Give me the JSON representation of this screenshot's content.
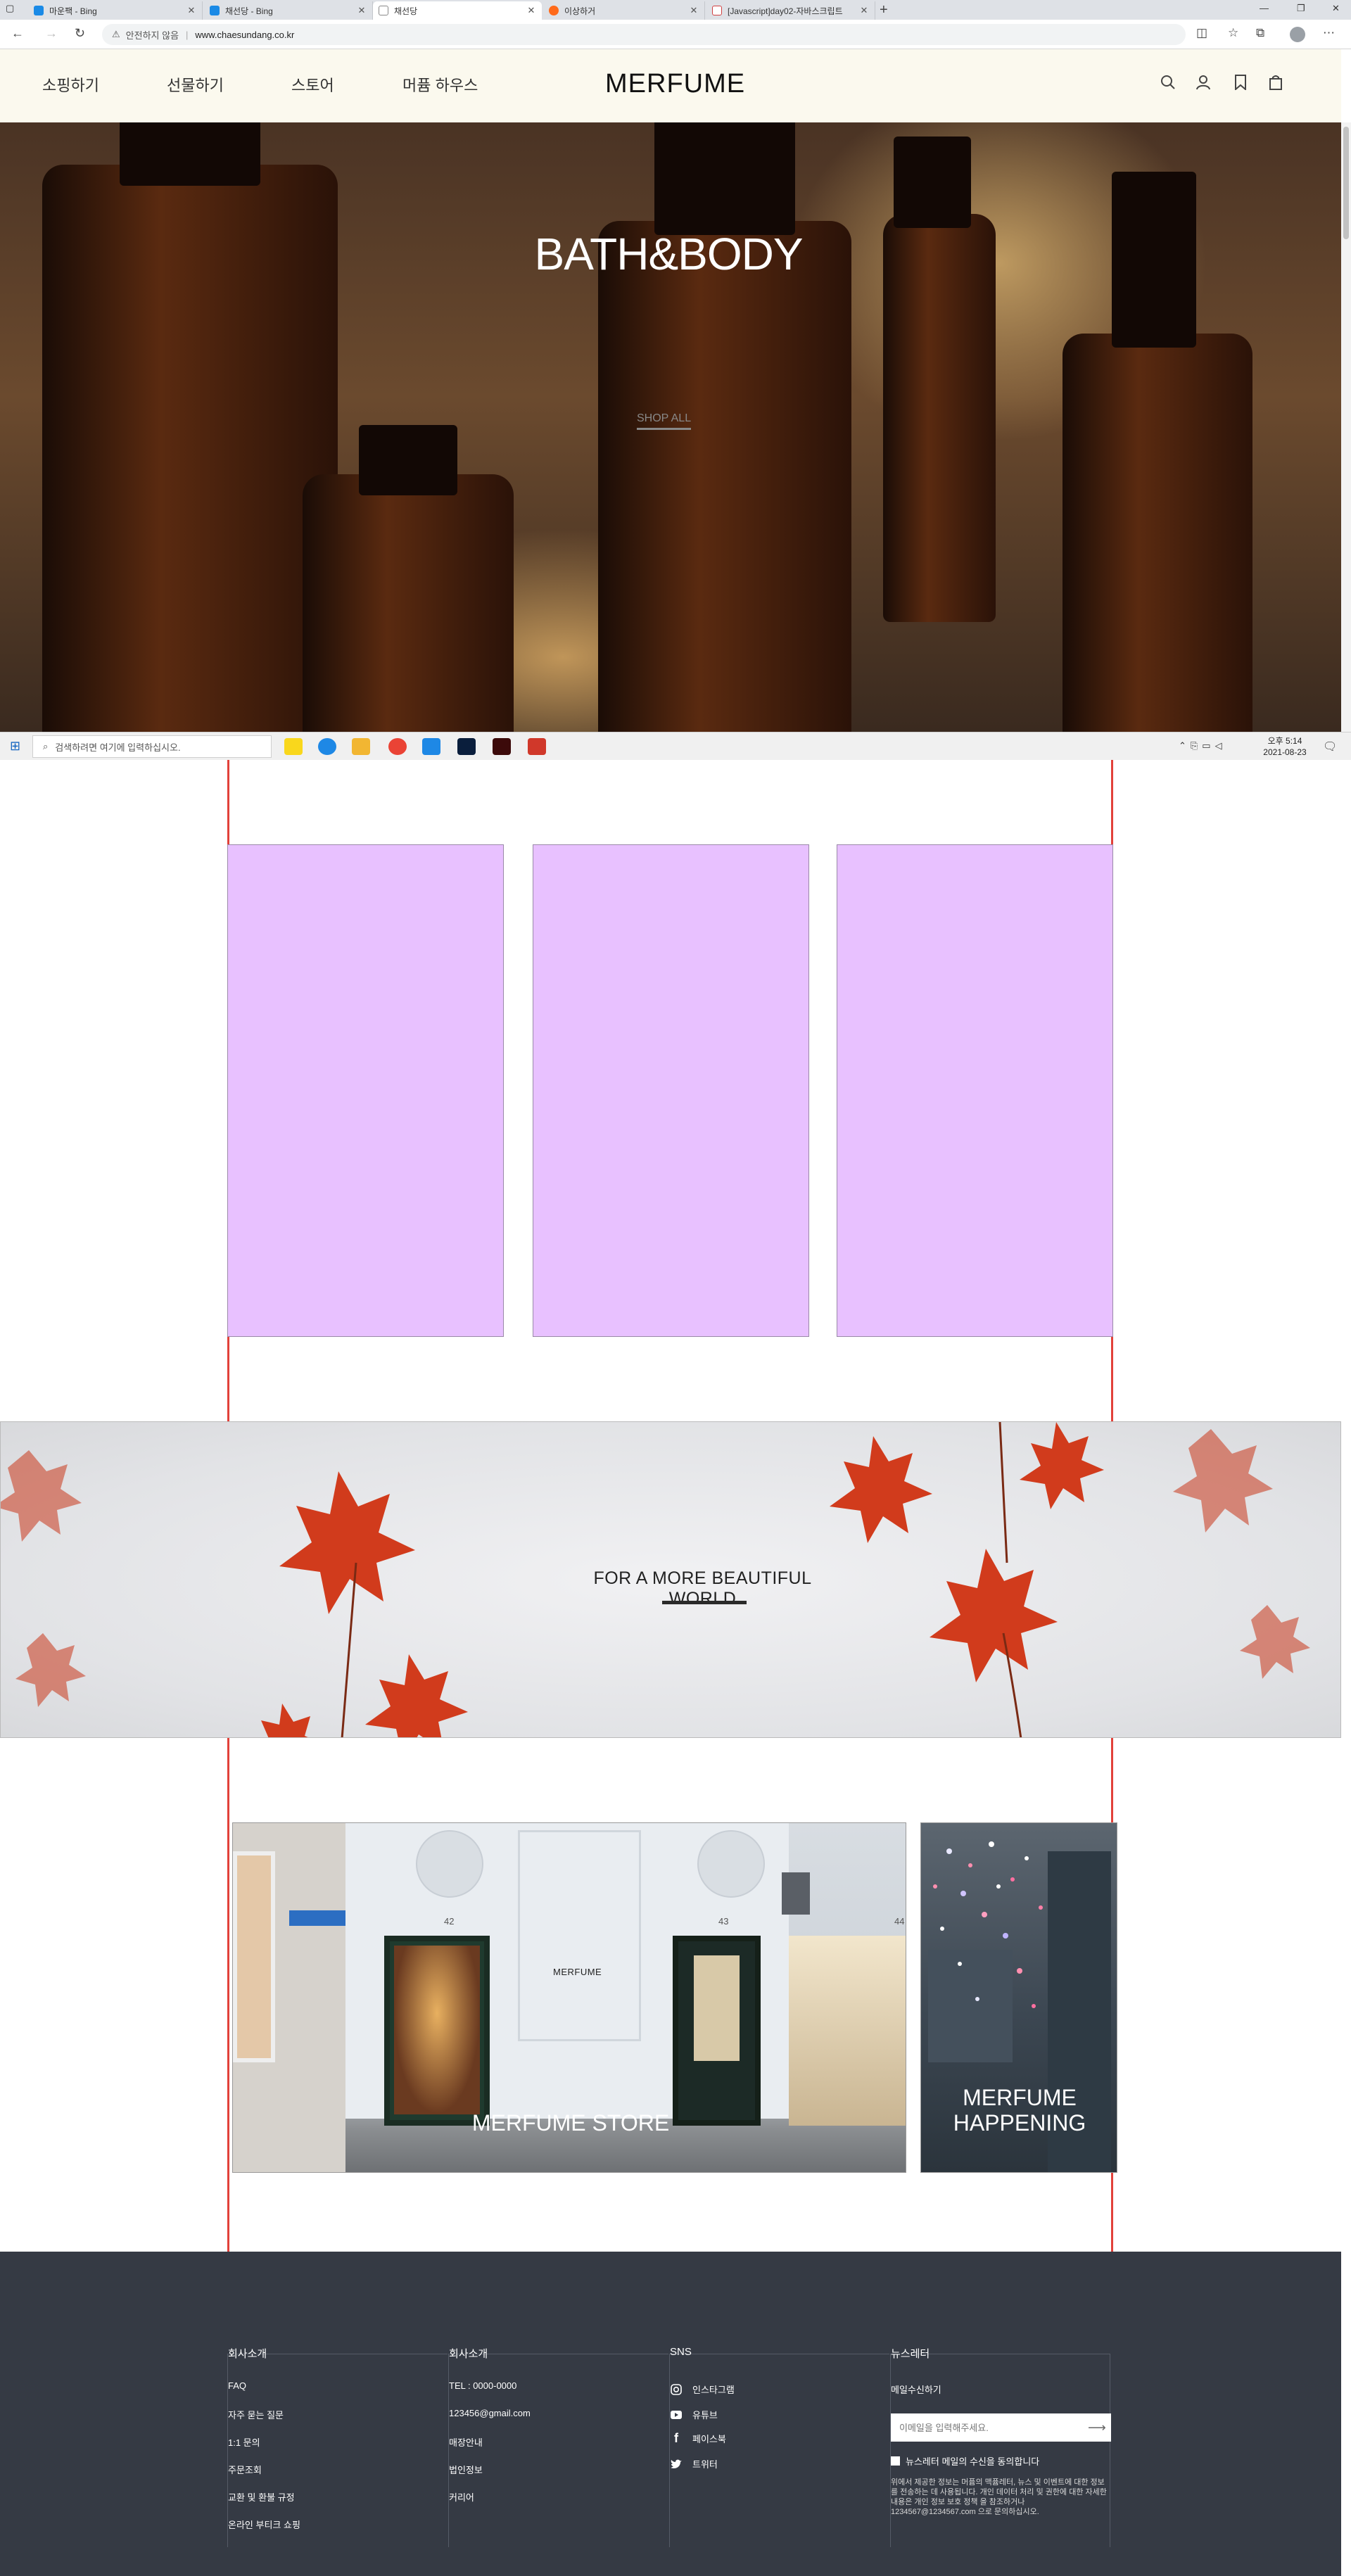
{
  "browser": {
    "tabs": [
      {
        "label": "마운팩 - Bing",
        "favicon_color": "#1a8ae6"
      },
      {
        "label": "채선당 - Bing",
        "favicon_color": "#1a8ae6"
      },
      {
        "label": "채선당",
        "favicon_color": "#888888"
      },
      {
        "label": "이상하거",
        "favicon_color": "#ff6a1a"
      },
      {
        "label": "[Javascript]day02-자바스크립트",
        "favicon_color": "#d04040"
      }
    ],
    "security_label": "안전하지 않음",
    "url": "www.chaesundang.co.kr"
  },
  "header": {
    "menu": [
      "소핑하기",
      "선물하기",
      "스토어",
      "머퓸 하우스"
    ],
    "logo": "MERFUME"
  },
  "hero": {
    "title": "BATH&BODY",
    "cta": "SHOP ALL"
  },
  "taskbar": {
    "search_placeholder": "검색하려면 여기에 입력하십시오.",
    "time": "오후 5:14",
    "date": "2021-08-23"
  },
  "cards": {
    "count": 3,
    "color": "#e8c1ff"
  },
  "banner": {
    "title": "FOR A MORE BEAUTIFUL WORLD"
  },
  "stores": {
    "store_label": "MERFUME STORE",
    "store_sign": "MERFUME",
    "door_numbers": [
      "42",
      "43",
      "44"
    ],
    "happening_label": "MERFUME HAPPENING"
  },
  "footer": {
    "columns": [
      {
        "title": "회사소개",
        "links": [
          "FAQ",
          "자주 묻는 질문",
          "1:1 문의",
          "주문조회",
          "교환 및 환불 규정",
          "온라인 부티크 쇼핑"
        ]
      },
      {
        "title": "회사소개",
        "links": [
          "TEL : 0000-0000",
          "123456@gmail.com",
          "매장안내",
          "법인정보",
          "커리어"
        ]
      },
      {
        "title": "SNS",
        "links": [
          "인스타그램",
          "유튜브",
          "페이스북",
          "트위터"
        ]
      },
      {
        "title": "뉴스레터"
      }
    ],
    "newsletter": {
      "subtitle": "메일수신하기",
      "placeholder": "이메일을 입력해주세요.",
      "agree": "뉴스레터 메일의 수신을 동의합니다",
      "note": "위에서 제공한 정보는 머퓸의 맥퓸레터, 뉴스 및 이벤트에 대한 정보를 전송하는 데 사용됩니다. 개인 데이터 처리 및 권한에 대한 자세한 내용은 개인 정보 보호 정책 을 참조하거나 1234567@1234567.com 으로 문의하십시오."
    }
  },
  "colors": {
    "header_bg": "#fbf9ee",
    "guide_line": "#e2413a",
    "footer_bg": "#353a44"
  }
}
